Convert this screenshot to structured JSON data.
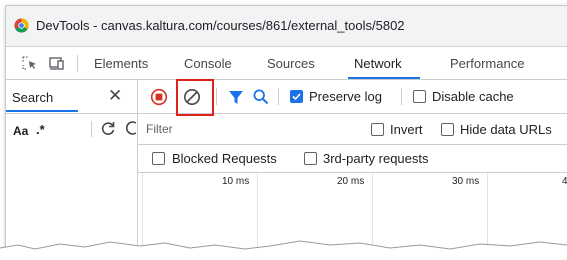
{
  "window": {
    "title": "DevTools - canvas.kaltura.com/courses/861/external_tools/5802"
  },
  "tabs": [
    {
      "label": "Elements"
    },
    {
      "label": "Console"
    },
    {
      "label": "Sources"
    },
    {
      "label": "Network"
    },
    {
      "label": "Performance"
    }
  ],
  "active_tab": "Network",
  "search_pane": {
    "title": "Search",
    "match_case_label": "Aa",
    "regex_label": ".*"
  },
  "network_toolbar": {
    "preserve_log": {
      "label": "Preserve log",
      "checked": true
    },
    "disable_cache": {
      "label": "Disable cache",
      "checked": false
    }
  },
  "filter": {
    "placeholder": "Filter",
    "value": "",
    "invert_label": "Invert",
    "hide_data_urls_label": "Hide data URLs"
  },
  "request_filters": {
    "blocked_requests_label": "Blocked Requests",
    "third_party_label": "3rd-party requests"
  },
  "timeline": {
    "ticks": [
      "10 ms",
      "20 ms",
      "30 ms",
      "4"
    ]
  },
  "colors": {
    "accent": "#1a73e8",
    "record_red": "#d93025",
    "highlight_red": "#e0201c"
  },
  "icons": [
    "chrome-icon",
    "select-element-icon",
    "device-toolbar-icon",
    "close-icon",
    "refresh-icon",
    "clear-icon",
    "record-stop-icon",
    "clear-network-log-icon",
    "filter-icon",
    "search-icon"
  ]
}
